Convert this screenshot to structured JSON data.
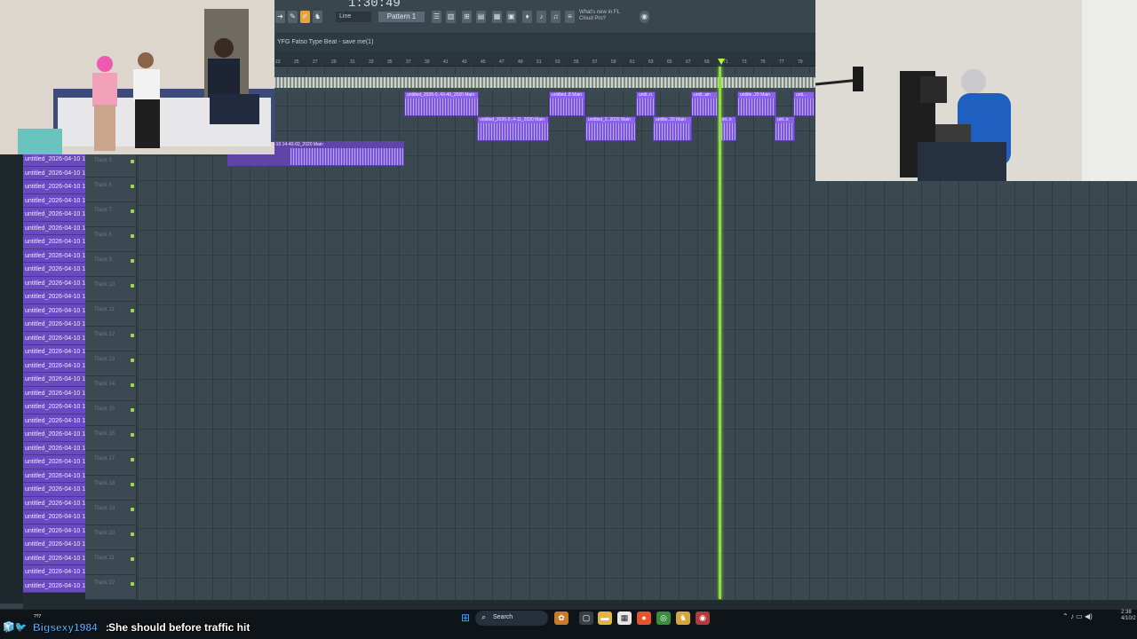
{
  "fl_studio": {
    "time_display": "1:30:49",
    "snap_mode": "Line",
    "pattern_selector": "Pattern 1",
    "news_text_line1": "What's new in FL",
    "news_text_line2": "Cloud Pro?",
    "project_title": "YFG Fatso Type Beat - save me(1)",
    "timeline_bars": [
      "23",
      "25",
      "27",
      "29",
      "31",
      "33",
      "35",
      "37",
      "39",
      "41",
      "43",
      "45",
      "47",
      "49",
      "51",
      "53",
      "55",
      "57",
      "59",
      "61",
      "63",
      "65",
      "67",
      "69",
      "71",
      "73",
      "75",
      "77",
      "79"
    ]
  },
  "browser_items": [
    "untitled_2026-04-10 14-",
    "untitled_2026-04-10 14-",
    "untitled_2026-04-10 14-",
    "untitled_2026-04-10 14-",
    "untitled_2026-04-10 14-",
    "untitled_2026-04-10 14-",
    "untitled_2026-04-10 14-",
    "untitled_2026-04-10 14-",
    "untitled_2026-04-10 14-",
    "untitled_2026-04-10 14-",
    "untitled_2026-04-10 14-",
    "untitled_2026-04-10 14-",
    "untitled_2026-04-10 14-",
    "untitled_2026-04-10 14-",
    "untitled_2026-04-10 14-",
    "untitled_2026-04-10 14-",
    "untitled_2026-04-10 14-",
    "untitled_2026-04-10 14-",
    "untitled_2026-04-10 14-",
    "untitled_2026-04-10 14-",
    "untitled_2026-04-10 14-",
    "untitled_2026-04-10 14-",
    "untitled_2026-04-10 14-",
    "untitled_2026-04-10 14-",
    "untitled_2026-04-10 14-",
    "untitled_2026-04-10 14-",
    "untitled_2026-04-10 14-",
    "untitled_2026-04-10 14-",
    "untitled_2026-04-10 14-",
    "untitled_2026-04-10 14-",
    "untitled_2026-04-10 14-",
    "untitled_2026-04-10 14-"
  ],
  "track_names": [
    "Track 5",
    "Track 6",
    "Track 7",
    "Track 8",
    "Track 9",
    "Track 10",
    "Track 11",
    "Track 12",
    "Track 13",
    "Track 14",
    "Track 15",
    "Track 16",
    "Track 17",
    "Track 18",
    "Track 19",
    "Track 20",
    "Track 21",
    "Track 22"
  ],
  "clips": {
    "row1": [
      "untitled_2026-0..43-40_2020 Main",
      "untitled..8 Main",
      "untit..n",
      "untit..ain",
      "untitle..20 Main",
      "unti..."
    ],
    "row2": [
      "untitled_2026-0..4-11_2020 Main",
      "untitled_2..2020 Main",
      "untitle..20 Main",
      "unt..n",
      "unt..n"
    ],
    "row3": "-10 14-40-02_2020 Main"
  },
  "taskbar": {
    "search_label": "Search",
    "clock_time": "2:38",
    "clock_date": "4/10/2"
  },
  "chat": {
    "username": "Bigsexy1984",
    "separator": ":",
    "message": "She should before traffic hit",
    "tiny_label": "??7"
  },
  "colors": {
    "clip_purple": "#8a63e6",
    "playhead_green": "#8fe03c",
    "chat_user": "#59b0ff"
  }
}
